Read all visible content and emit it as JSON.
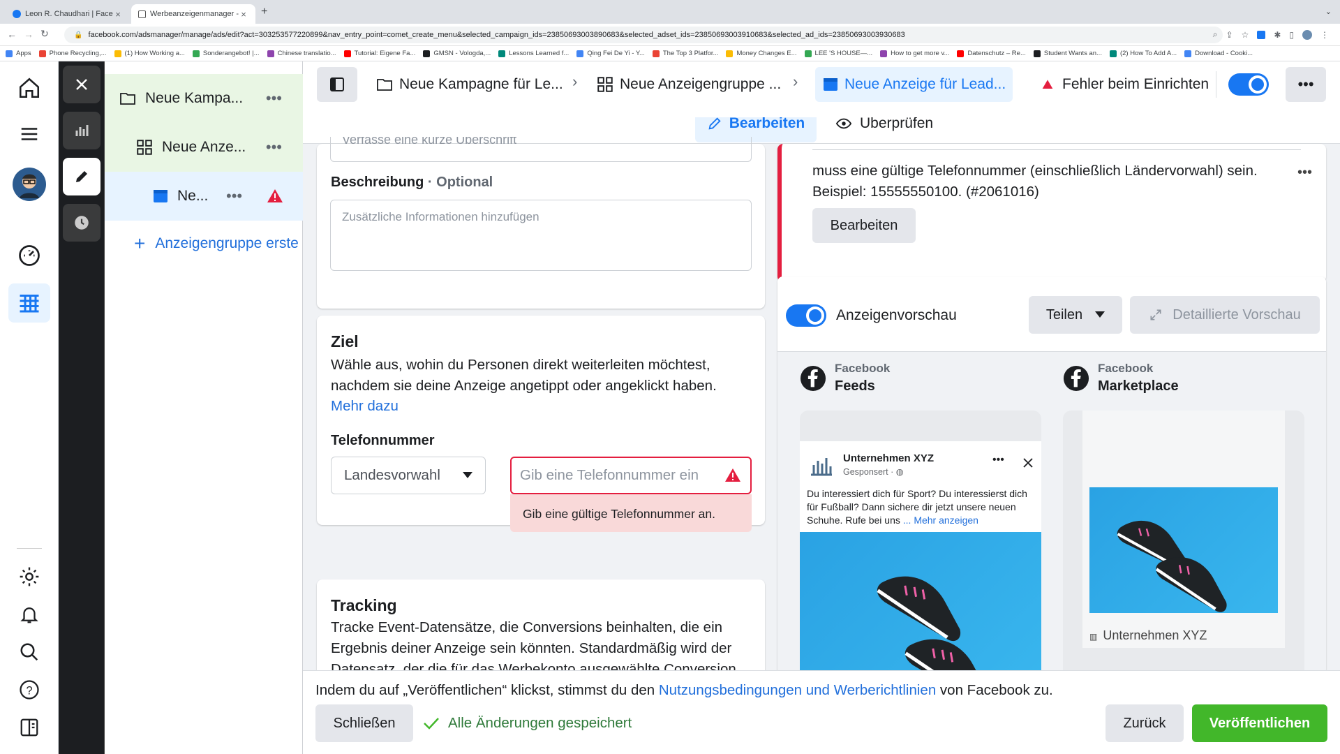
{
  "browser": {
    "tabs": [
      {
        "title": "Leon R. Chaudhari | Facebook"
      },
      {
        "title": "Werbeanzeigenmanager - Wer"
      }
    ],
    "url": "facebook.com/adsmanager/manage/ads/edit?act=303253577220899&nav_entry_point=comet_create_menu&selected_campaign_ids=23850693003890683&selected_adset_ids=23850693003910683&selected_ad_ids=23850693003930683",
    "bookmarks": [
      "Apps",
      "Phone Recycling,...",
      "(1) How Working a...",
      "Sonderangebot! |...",
      "Chinese translatio...",
      "Tutorial: Eigene Fa...",
      "GMSN - Vologda,...",
      "Lessons Learned f...",
      "Qing Fei De Yi - Y...",
      "The Top 3 Platfor...",
      "Money Changes E...",
      "LEE 'S HOUSE—...",
      "How to get more v...",
      "Datenschutz – Re...",
      "Student Wants an...",
      "(2) How To Add A...",
      "Download - Cooki..."
    ]
  },
  "tree": {
    "campaign": "Neue Kampa...",
    "adset": "Neue Anze...",
    "ad": "Ne...",
    "create_adset": "Anzeigengruppe erste"
  },
  "topbar": {
    "crumb_campaign": "Neue Kampagne für Le...",
    "crumb_adset": "Neue Anzeigengruppe ...",
    "crumb_ad": "Neue Anzeige für Lead...",
    "error_status": "Fehler beim Einrichten",
    "edit_tab": "Bearbeiten",
    "review_tab": "Überprüfen"
  },
  "form": {
    "headline_placeholder": "Verfasse eine kurze Überschrift",
    "description_label": "Beschreibung",
    "description_optional": "· Optional",
    "description_placeholder": "Zusätzliche Informationen hinzufügen",
    "ziel_title": "Ziel",
    "ziel_text": "Wähle aus, wohin du Personen direkt weiterleiten möchtest, nachdem sie deine Anzeige angetippt oder angeklickt haben.",
    "more_link": "Mehr dazu",
    "phone_label": "Telefonnummer",
    "country_select": "Landesvorwahl",
    "phone_placeholder": "Gib eine Telefonnummer ein",
    "phone_error": "Gib eine gültige Telefonnummer an.",
    "tracking_title": "Tracking",
    "tracking_text": "Tracke Event-Datensätze, die Conversions beinhalten, die ein Ergebnis deiner Anzeige sein könnten. Standardmäßig wird der Datensatz, der die für das Werbekonto ausgewählte Conversion"
  },
  "error_card": {
    "text": "muss eine gültige Telefonnummer (einschließlich Ländervorwahl) sein. Beispiel: 15555550100. (#2061016)",
    "edit_button": "Bearbeiten"
  },
  "preview": {
    "toggle_label": "Anzeigenvorschau",
    "share_button": "Teilen",
    "detail_button": "Detaillierte Vorschau",
    "placement1_platform": "Facebook",
    "placement1_name": "Feeds",
    "placement2_platform": "Facebook",
    "placement2_name": "Marketplace",
    "page_name": "Unternehmen XYZ",
    "sponsored": "Gesponsert ·",
    "ad_text": "Du interessiert dich für Sport? Du interessierst dich für Fußball? Dann sichere dir jetzt unsere neuen Schuhe. Rufe bei uns",
    "more": "... Mehr anzeigen",
    "page_name_2": "Unternehmen XYZ"
  },
  "footer": {
    "terms_before": "Indem du auf „Veröffentlichen“ klickst, stimmst du den ",
    "terms_link": "Nutzungsbedingungen und Werberichtlinien",
    "terms_after": " von Facebook zu.",
    "close_button": "Schließen",
    "saved_status": "Alle Änderungen gespeichert",
    "back_button": "Zurück",
    "publish_button": "Veröffentlichen"
  },
  "colors": {
    "accent": "#1877f2",
    "link": "#216fdb",
    "error": "#e41e3f",
    "publish": "#42b72a",
    "selected_tree": "#e7f3ff",
    "tree_highlight": "#e9f6e4"
  }
}
